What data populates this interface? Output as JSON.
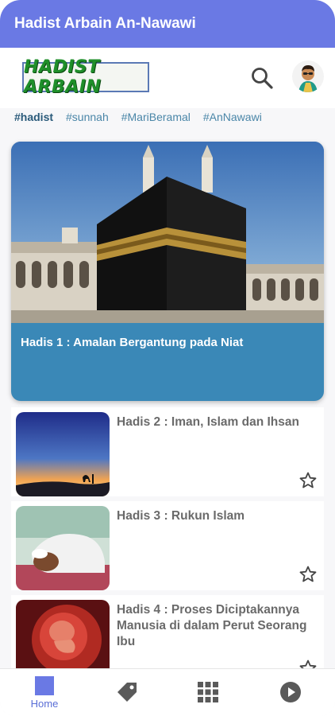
{
  "app": {
    "title": "Hadist Arbain An-Nawawi",
    "accent": "#6a79e4"
  },
  "header": {
    "logo_text": "HADIST ARBAIN",
    "search_icon": "search-icon",
    "avatar_icon": "avatar-icon"
  },
  "tags": [
    "#hadist",
    "#sunnah",
    "#MariBeramal",
    "#AnNawawi"
  ],
  "featured": {
    "title": "Hadis 1 : Amalan Bergantung pada Niat"
  },
  "items": [
    {
      "title": "Hadis 2 : Iman, Islam dan Ihsan"
    },
    {
      "title": "Hadis 3 : Rukun Islam"
    },
    {
      "title": "Hadis 4 : Proses Diciptakannya Manusia di dalam Perut Seorang Ibu"
    }
  ],
  "nav": [
    {
      "label": "Home",
      "icon": "home-icon",
      "active": true
    },
    {
      "label": "",
      "icon": "tag-icon"
    },
    {
      "label": "",
      "icon": "grid-icon"
    },
    {
      "label": "",
      "icon": "play-icon"
    }
  ]
}
